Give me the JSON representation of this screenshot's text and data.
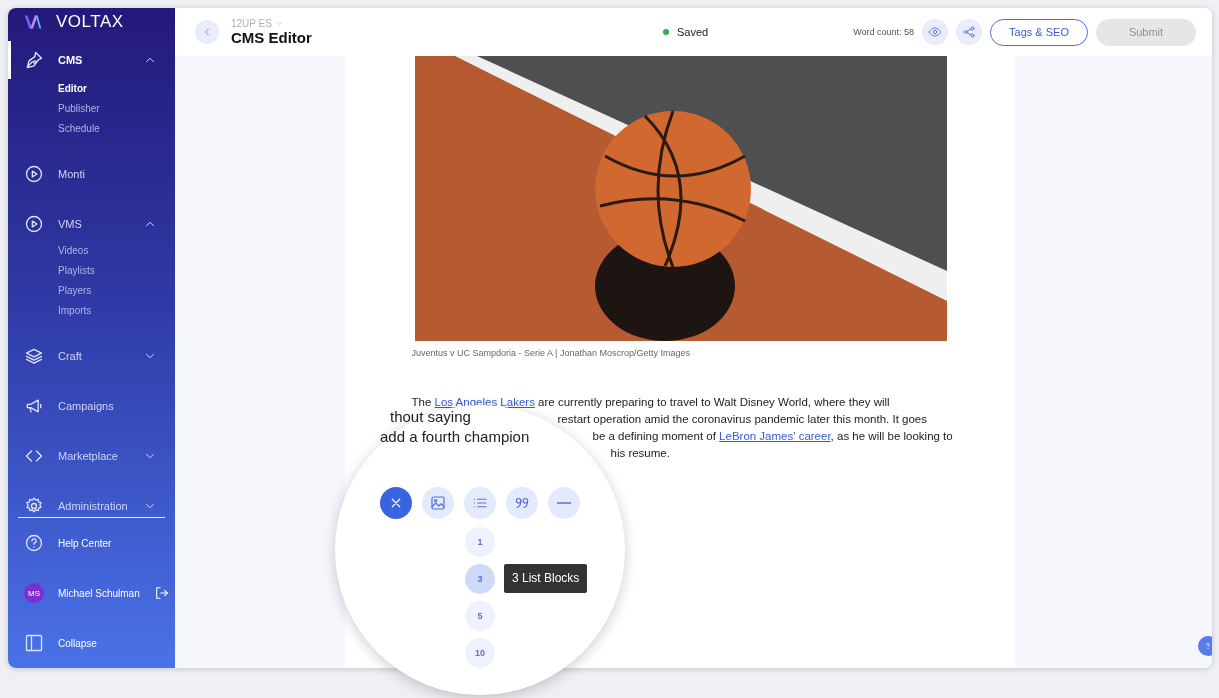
{
  "app": {
    "logo": "VOLTAX"
  },
  "sidebar": {
    "items": [
      {
        "kind": "pen",
        "label": "CMS",
        "selected": true,
        "expanded": true,
        "children": [
          {
            "label": "Editor",
            "selected": true
          },
          {
            "label": "Publisher",
            "selected": false
          },
          {
            "label": "Schedule",
            "selected": false
          }
        ]
      },
      {
        "kind": "play",
        "label": "Monti",
        "selected": false
      },
      {
        "kind": "play",
        "label": "VMS",
        "selected": false,
        "expanded": true,
        "children": [
          {
            "label": "Videos",
            "selected": false
          },
          {
            "label": "Playlists",
            "selected": false
          },
          {
            "label": "Players",
            "selected": false
          },
          {
            "label": "Imports",
            "selected": false
          }
        ]
      },
      {
        "kind": "layers",
        "label": "Craft",
        "selected": false,
        "expanded": false
      },
      {
        "kind": "megaphone",
        "label": "Campaigns",
        "selected": false
      },
      {
        "kind": "code",
        "label": "Marketplace",
        "selected": false,
        "expanded": false
      },
      {
        "kind": "gear",
        "label": "Administration",
        "selected": false,
        "expanded": false
      }
    ],
    "footer": [
      {
        "kind": "help",
        "label": "Help Center"
      },
      {
        "kind": "user",
        "label": "Michael Schulman",
        "initials": "MS"
      },
      {
        "kind": "collapse",
        "label": "Collapse"
      }
    ]
  },
  "header": {
    "breadcrumb": "12UP ES",
    "title": "CMS Editor",
    "status": "Saved",
    "word_count": "Word count: 58",
    "buttons": [
      {
        "label": "Tags & SEO",
        "disabled": false
      },
      {
        "label": "Submit",
        "disabled": true
      }
    ]
  },
  "article": {
    "caption": "Juventus v UC Sampdoria - Serie A | Jonathan Moscrop/Getty Images",
    "lines": [
      [
        {
          "text": "The "
        },
        {
          "text": "Los Angeles Lakers",
          "link": true
        },
        {
          "text": " are currently preparing to travel to Walt Disney World, where they will"
        }
      ],
      [
        {
          "text": "restart operation amid the coronavirus pandemic later this month. It goes"
        }
      ],
      [
        {
          "text": "be a defining moment of "
        },
        {
          "text": "LeBron James' career",
          "link": true
        },
        {
          "text": ", as he will be looking to"
        }
      ],
      [
        {
          "text": "his resume."
        }
      ]
    ]
  },
  "magnifier": {
    "fragments": [
      "thout saying",
      "add a fourth champion"
    ],
    "tools": [
      {
        "kind": "close",
        "selected": true
      },
      {
        "kind": "image",
        "selected": false
      },
      {
        "kind": "list",
        "selected": false
      },
      {
        "kind": "quote",
        "selected": false
      },
      {
        "kind": "divider",
        "selected": false
      }
    ],
    "counts": [
      {
        "label": "1",
        "selected": false
      },
      {
        "label": "3",
        "selected": true
      },
      {
        "label": "5",
        "selected": false
      },
      {
        "label": "10",
        "selected": false
      }
    ],
    "tooltip": "3 List Blocks"
  }
}
